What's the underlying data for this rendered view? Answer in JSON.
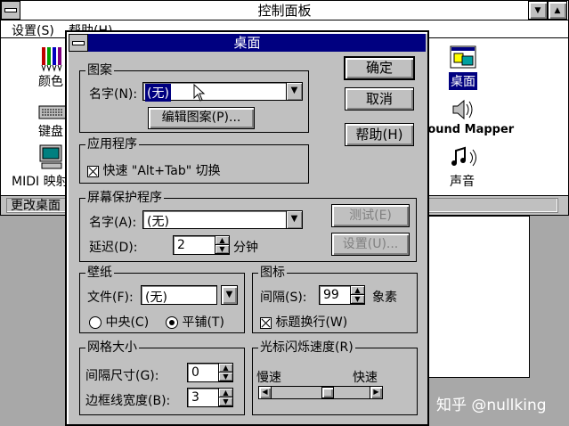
{
  "control_panel": {
    "title": "控制面板",
    "menu": [
      "设置(S)",
      "帮助(H)"
    ],
    "status": "更改桌面",
    "icons": {
      "color": "颜色",
      "keyboard": "键盘",
      "midi": "MIDI 映射",
      "desktop": "桌面",
      "sound_mapper": "Sound Mapper",
      "sound": "声音"
    }
  },
  "dialog": {
    "title": "桌面",
    "buttons": {
      "ok": "确定",
      "cancel": "取消",
      "help": "帮助(H)"
    },
    "pattern": {
      "group": "图案",
      "name_label": "名字(N):",
      "name_value": "(无)",
      "edit_button": "编辑图案(P)..."
    },
    "applications": {
      "group": "应用程序",
      "fast_switch_label": "快速 \"Alt+Tab\" 切换",
      "fast_switch_checked": true
    },
    "screen_saver": {
      "group": "屏幕保护程序",
      "name_label": "名字(A):",
      "name_value": "(无)",
      "delay_label": "延迟(D):",
      "delay_value": "2",
      "delay_unit": "分钟",
      "test_button": "测试(E)",
      "setup_button": "设置(U)..."
    },
    "wallpaper": {
      "group": "壁纸",
      "file_label": "文件(F):",
      "file_value": "(无)",
      "center_label": "中央(C)",
      "tile_label": "平铺(T)",
      "selected": "tile"
    },
    "icons": {
      "group": "图标",
      "spacing_label": "间隔(S):",
      "spacing_value": "99",
      "spacing_unit": "象素",
      "wrap_label": "标题换行(W)",
      "wrap_checked": true
    },
    "grid": {
      "group": "网格大小",
      "granularity_label": "间隔尺寸(G):",
      "granularity_value": "0",
      "border_label": "边框线宽度(B):",
      "border_value": "3"
    },
    "cursor_blink": {
      "group": "光标闪烁速度(R)",
      "slow_label": "慢速",
      "fast_label": "快速",
      "level": 0.5
    }
  },
  "watermark": "知乎 @nullking"
}
